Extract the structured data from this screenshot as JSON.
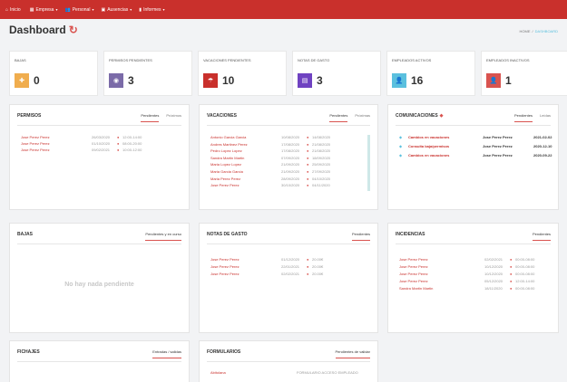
{
  "nav": {
    "items": [
      {
        "icon": "home-icon",
        "glyph": "⌂",
        "label": "Inicio",
        "caret": ""
      },
      {
        "icon": "building-icon",
        "glyph": "▦",
        "label": "Empresa",
        "caret": "▾"
      },
      {
        "icon": "users-icon",
        "glyph": "👥",
        "label": "Personal",
        "caret": "▾"
      },
      {
        "icon": "calendar-icon",
        "glyph": "▣",
        "label": "Ausencias",
        "caret": "▾"
      },
      {
        "icon": "chart-icon",
        "glyph": "▮",
        "label": "Informes",
        "caret": "▾"
      }
    ]
  },
  "header": {
    "title": "Dashboard",
    "refresh_icon": "↻",
    "breadcrumb": [
      "HOME",
      "DASHBOARD"
    ],
    "breadcrumb_sep": "/"
  },
  "stats": [
    {
      "label": "BAJAS",
      "value": "0",
      "color": "#f0ad4e",
      "icon": "medkit-icon",
      "glyph": "✚"
    },
    {
      "label": "PERMISOS PENDIENTES",
      "value": "3",
      "color": "#7b6ba8",
      "icon": "eye-icon",
      "glyph": "◉"
    },
    {
      "label": "VACACIONES PENDIENTES",
      "value": "10",
      "color": "#c9302c",
      "icon": "umbrella-icon",
      "glyph": "☂"
    },
    {
      "label": "NOTAS DE GASTO",
      "value": "3",
      "color": "#6f42c1",
      "icon": "receipt-icon",
      "glyph": "▤"
    },
    {
      "label": "EMPLEADOS ACTIVOS",
      "value": "16",
      "color": "#5bc0de",
      "icon": "user-icon",
      "glyph": "👤"
    },
    {
      "label": "EMPLEADOS INACTIVOS",
      "value": "1",
      "color": "#d9534f",
      "icon": "user-icon",
      "glyph": "👤"
    }
  ],
  "permisos": {
    "title": "PERMISOS",
    "tabs": [
      "Pendientes",
      "Próximos"
    ],
    "rows": [
      {
        "name": "Jose Perez Perez",
        "date": "26/03/2020",
        "time": "12:00-14:00"
      },
      {
        "name": "Jose Perez Perez",
        "date": "01/10/2020",
        "time": "08:00-20:00"
      },
      {
        "name": "Jose Perez Perez",
        "date": "09/02/2021",
        "time": "10:00-12:00"
      }
    ]
  },
  "vacaciones": {
    "title": "VACACIONES",
    "tabs": [
      "Pendientes",
      "Próximas"
    ],
    "rows": [
      {
        "name": "Antonio Garcia Garcia",
        "date": "10/08/2020",
        "time": "14/08/2020"
      },
      {
        "name": "Andres Martinez Perez",
        "date": "17/08/2020",
        "time": "21/08/2020"
      },
      {
        "name": "Pedro Lopez Lopez",
        "date": "17/08/2020",
        "time": "21/08/2020"
      },
      {
        "name": "Sandra Martin Martin",
        "date": "07/09/2020",
        "time": "18/09/2020"
      },
      {
        "name": "Maria Lopez Lopez",
        "date": "21/09/2020",
        "time": "25/09/2020"
      },
      {
        "name": "Maria Garcia Garcia",
        "date": "21/09/2020",
        "time": "27/09/2020"
      },
      {
        "name": "Maria Perez Perez",
        "date": "28/09/2020",
        "time": "04/10/2020"
      },
      {
        "name": "Jose Perez Perez",
        "date": "30/10/2020",
        "time": "04/11/2020"
      }
    ]
  },
  "comunicaciones": {
    "title": "COMUNICACIONES",
    "tabs": [
      "Pendientes",
      "Leídas"
    ],
    "rows": [
      {
        "subject": "Cambios en vacaciones",
        "author": "Jose Perez Perez",
        "date": "2021-02-02"
      },
      {
        "subject": "Consulta baja/permisos",
        "author": "Jose Perez Perez",
        "date": "2020-12-10"
      },
      {
        "subject": "Cambios en vacaciones",
        "author": "Jose Perez Perez",
        "date": "2020-09-22"
      }
    ]
  },
  "bajas": {
    "title": "BAJAS",
    "tabs": [
      "Pendientes y en curso"
    ],
    "empty": "No hay nada pendiente"
  },
  "notas": {
    "title": "NOTAS DE GASTO",
    "tabs": [
      "Pendientes"
    ],
    "rows": [
      {
        "name": "Jose Perez Perez",
        "date": "01/12/2020",
        "time": "20.00€"
      },
      {
        "name": "Jose Perez Perez",
        "date": "22/01/2021",
        "time": "20.00€"
      },
      {
        "name": "Jose Perez Perez",
        "date": "02/02/2021",
        "time": "20.00€"
      }
    ]
  },
  "incidencias": {
    "title": "INCIDENCIAS",
    "tabs": [
      "Pendientes"
    ],
    "rows": [
      {
        "name": "Jose Perez Perez",
        "date": "02/02/2021",
        "time": "00:00-08:00"
      },
      {
        "name": "Jose Perez Perez",
        "date": "10/12/2020",
        "time": "00:00-08:00"
      },
      {
        "name": "Jose Perez Perez",
        "date": "10/12/2020",
        "time": "00:00-08:00"
      },
      {
        "name": "Jose Perez Perez",
        "date": "05/12/2020",
        "time": "12:00-14:00"
      },
      {
        "name": "Sandra Martin Martin",
        "date": "18/11/2020",
        "time": "00:00-08:00"
      }
    ]
  },
  "fichajes": {
    "title": "FICHAJES",
    "tabs": [
      "Entradas / salidas"
    ]
  },
  "formularios": {
    "title": "FORMULARIOS",
    "tabs": [
      "Pendientes de validar"
    ],
    "rows": [
      {
        "name": "Abitolana",
        "value": "FORMULARIO ACCESO EMPLEADO"
      }
    ]
  }
}
